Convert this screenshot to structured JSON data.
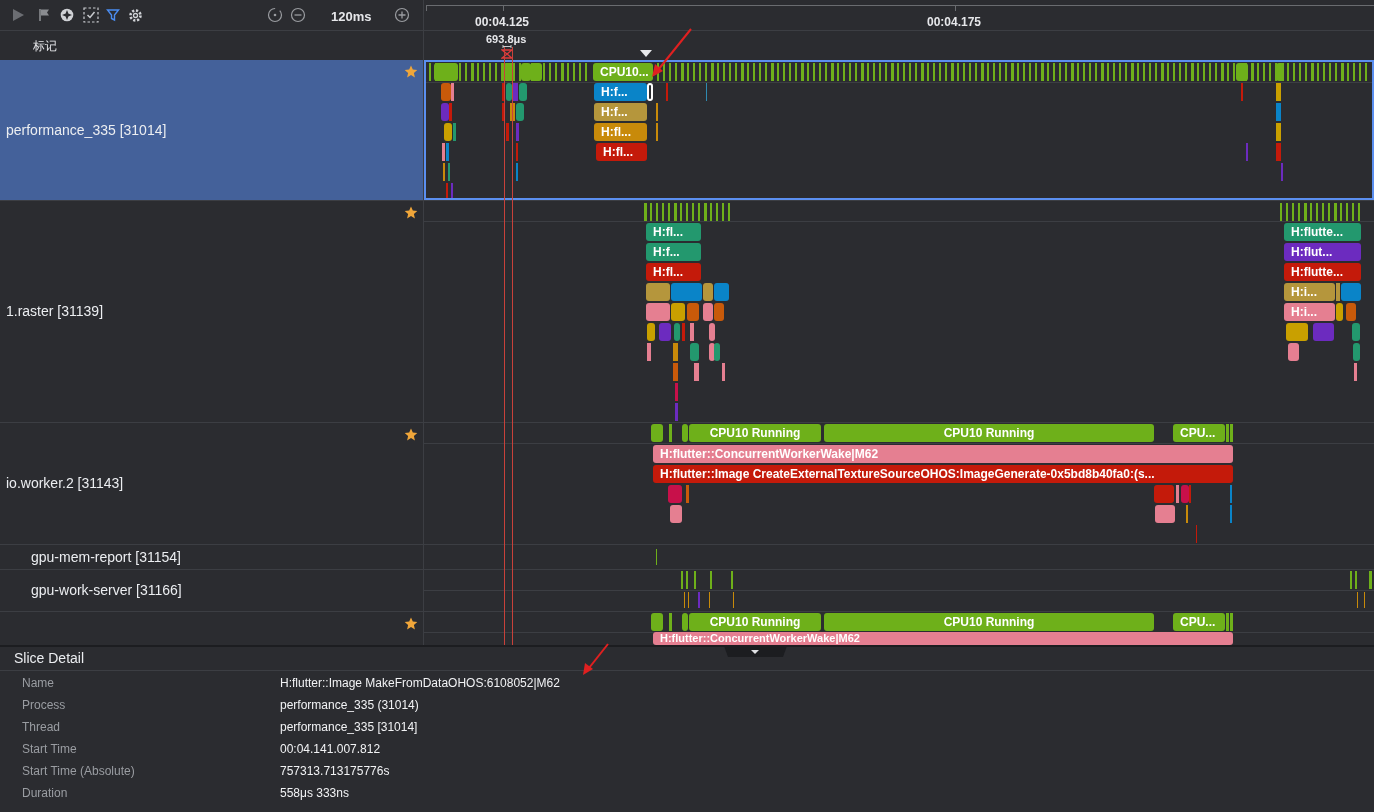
{
  "toolbar": {
    "zoom": "120ms"
  },
  "ruler": {
    "ticks": [
      "00:04.125",
      "00:04.175"
    ]
  },
  "marker_row": {
    "label": "标记",
    "span": "693.8μs"
  },
  "tracks": [
    {
      "name": "performance_335 [31014]",
      "starred": true,
      "selected": true,
      "slices": [
        {
          "label": "CPU10...",
          "color": "#6eb01a"
        },
        {
          "label": "H:f...",
          "color": "#0a84c8"
        },
        {
          "label": "H:f...",
          "color": "#b5963c"
        },
        {
          "label": "H:fl...",
          "color": "#c88a0a"
        },
        {
          "label": "H:fl...",
          "color": "#c41a0a"
        }
      ]
    },
    {
      "name": "1.raster [31139]",
      "starred": true,
      "selected": false,
      "slices": [
        {
          "label": "H:fl...",
          "color": "#23986e"
        },
        {
          "label": "H:f...",
          "color": "#23986e"
        },
        {
          "label": "H:fl...",
          "color": "#c41a0a"
        },
        {
          "label": "H:flutte...",
          "color": "#23986e"
        },
        {
          "label": "H:flut...",
          "color": "#6c2bbf"
        },
        {
          "label": "H:flutte...",
          "color": "#c41a0a"
        },
        {
          "label": "H:i...",
          "color": "#b5963c"
        },
        {
          "label": "H:i...",
          "color": "#e57f91"
        }
      ]
    },
    {
      "name": "io.worker.2 [31143]",
      "starred": true,
      "selected": false,
      "slices": [
        {
          "label": "CPU10 Running",
          "color": "#6eb01a"
        },
        {
          "label": "CPU10 Running",
          "color": "#6eb01a"
        },
        {
          "label": "CPU...",
          "color": "#6eb01a"
        },
        {
          "label": "H:flutter::ConcurrentWorkerWake|M62",
          "color": "#e57f91"
        },
        {
          "label": "H:flutter::Image CreateExternalTextureSourceOHOS:ImageGenerate-0x5bd8b40fa0:(s...",
          "color": "#c41a0a"
        }
      ]
    },
    {
      "name": "gpu-mem-report [31154]",
      "starred": false,
      "selected": false
    },
    {
      "name": "gpu-work-server [31166]",
      "starred": false,
      "selected": false
    },
    {
      "starred": true,
      "selected": false,
      "slices": [
        {
          "label": "CPU10 Running",
          "color": "#6eb01a"
        },
        {
          "label": "CPU10 Running",
          "color": "#6eb01a"
        },
        {
          "label": "CPU...",
          "color": "#6eb01a"
        },
        {
          "label": "H:flutter::ConcurrentWorkerWake|M62",
          "color": "#e57f91"
        }
      ]
    }
  ],
  "slice_detail": {
    "title": "Slice Detail",
    "fields": [
      {
        "label": "Name",
        "value": "H:flutter::Image MakeFromDataOHOS:6108052|M62"
      },
      {
        "label": "Process",
        "value": "performance_335 (31014)"
      },
      {
        "label": "Thread",
        "value": "performance_335 [31014]"
      },
      {
        "label": "Start Time",
        "value": "00:04.141.007.812"
      },
      {
        "label": "Start Time (Absolute)",
        "value": "757313.713175776s"
      },
      {
        "label": "Duration",
        "value": "558μs 333ns"
      }
    ]
  }
}
